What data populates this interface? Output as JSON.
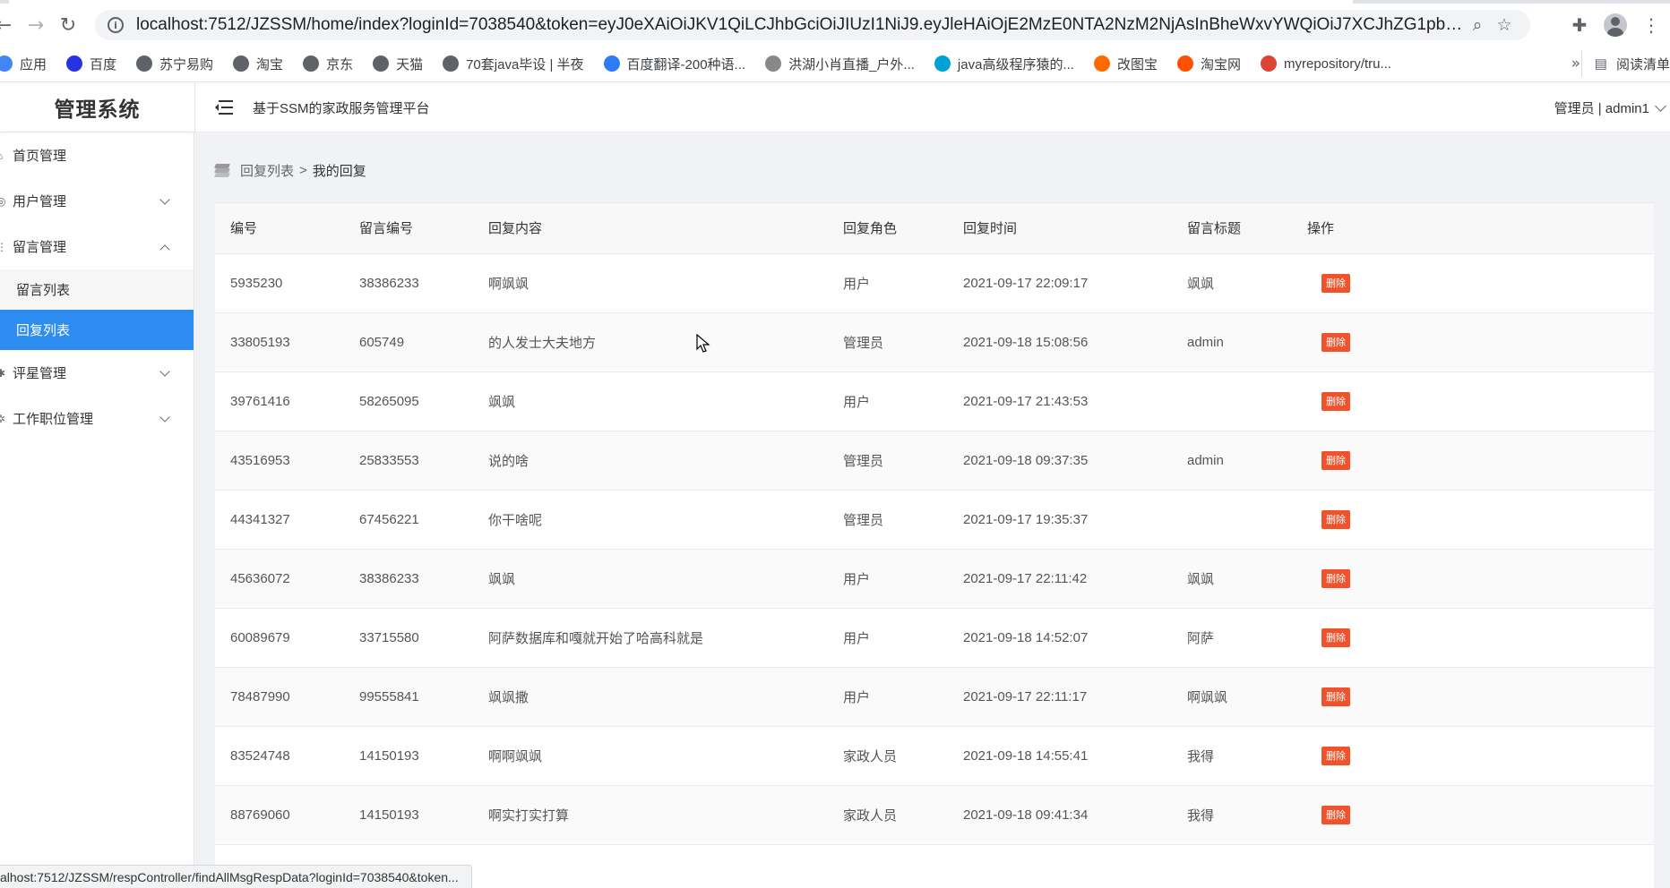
{
  "browser": {
    "url": "localhost:7512/JZSSM/home/index?loginId=7038540&token=eyJ0eXAiOiJKV1QiLCJhbGciOiJIUzI1NiJ9.eyJleHAiOjE2MzE0NTA2NzM2NjAsInBheWxvYWQiOiJ7XCJhZG1pbklkXCI6Nz...",
    "bookmarks": [
      {
        "label": "应用",
        "color": "#4285f4"
      },
      {
        "label": "百度",
        "color": "#2932e1"
      },
      {
        "label": "苏宁易购",
        "color": "#5f6368"
      },
      {
        "label": "淘宝",
        "color": "#5f6368"
      },
      {
        "label": "京东",
        "color": "#5f6368"
      },
      {
        "label": "天猫",
        "color": "#5f6368"
      },
      {
        "label": "70套java毕设 | 半夜",
        "color": "#5f6368"
      },
      {
        "label": "百度翻译-200种语...",
        "color": "#2d7cf6"
      },
      {
        "label": "洪湖小肖直播_户外...",
        "color": "#888888"
      },
      {
        "label": "java高级程序猿的...",
        "color": "#00a1d6"
      },
      {
        "label": "改图宝",
        "color": "#ff6a00"
      },
      {
        "label": "淘宝网",
        "color": "#ff5000"
      },
      {
        "label": "myrepository/tru...",
        "color": "#db4437"
      }
    ],
    "bookmarks_more": "»",
    "reading_list": "阅读清单",
    "status_url": "alhost:7512/JZSSM/respController/findAllMsgRespData?loginId=7038540&token..."
  },
  "header": {
    "logo": "管理系统",
    "title": "基于SSM的家政服务管理平台",
    "user": "管理员 | admin1"
  },
  "sidebar": {
    "items": [
      {
        "label": "首页管理",
        "icon": "⌂"
      },
      {
        "label": "用户管理",
        "icon": "◎"
      },
      {
        "label": "留言管理",
        "icon": "⋮"
      },
      {
        "label": "评星管理",
        "icon": "✱"
      },
      {
        "label": "工作职位管理",
        "icon": "✲"
      }
    ],
    "sub_items": [
      {
        "label": "留言列表"
      },
      {
        "label": "回复列表"
      }
    ]
  },
  "breadcrumb": {
    "parent": "回复列表",
    "separator": ">",
    "current": "我的回复"
  },
  "table": {
    "headers": [
      "编号",
      "留言编号",
      "回复内容",
      "回复角色",
      "回复时间",
      "留言标题",
      "操作"
    ],
    "delete_label": "删除",
    "rows": [
      [
        "5935230",
        "38386233",
        "啊飒飒",
        "用户",
        "2021-09-17 22:09:17",
        "飒飒"
      ],
      [
        "33805193",
        "605749",
        "的人发士大夫地方",
        "管理员",
        "2021-09-18 15:08:56",
        "admin"
      ],
      [
        "39761416",
        "58265095",
        "飒飒",
        "用户",
        "2021-09-17 21:43:53",
        ""
      ],
      [
        "43516953",
        "25833553",
        "说的啥",
        "管理员",
        "2021-09-18 09:37:35",
        "admin"
      ],
      [
        "44341327",
        "67456221",
        "你干啥呢",
        "管理员",
        "2021-09-17 19:35:37",
        ""
      ],
      [
        "45636072",
        "38386233",
        "飒飒",
        "用户",
        "2021-09-17 22:11:42",
        "飒飒"
      ],
      [
        "60089679",
        "33715580",
        "阿萨数据库和嘎就开始了哈高科就是",
        "用户",
        "2021-09-18 14:52:07",
        "阿萨"
      ],
      [
        "78487990",
        "99555841",
        "飒飒撒",
        "用户",
        "2021-09-17 22:11:17",
        "啊飒飒"
      ],
      [
        "83524748",
        "14150193",
        "啊啊飒飒",
        "家政人员",
        "2021-09-18 14:55:41",
        "我得"
      ],
      [
        "88769060",
        "14150193",
        "啊实打实打算",
        "家政人员",
        "2021-09-18 09:41:34",
        "我得"
      ]
    ]
  },
  "colors": {
    "accent": "#2d8cf0",
    "danger": "#f0522b"
  }
}
